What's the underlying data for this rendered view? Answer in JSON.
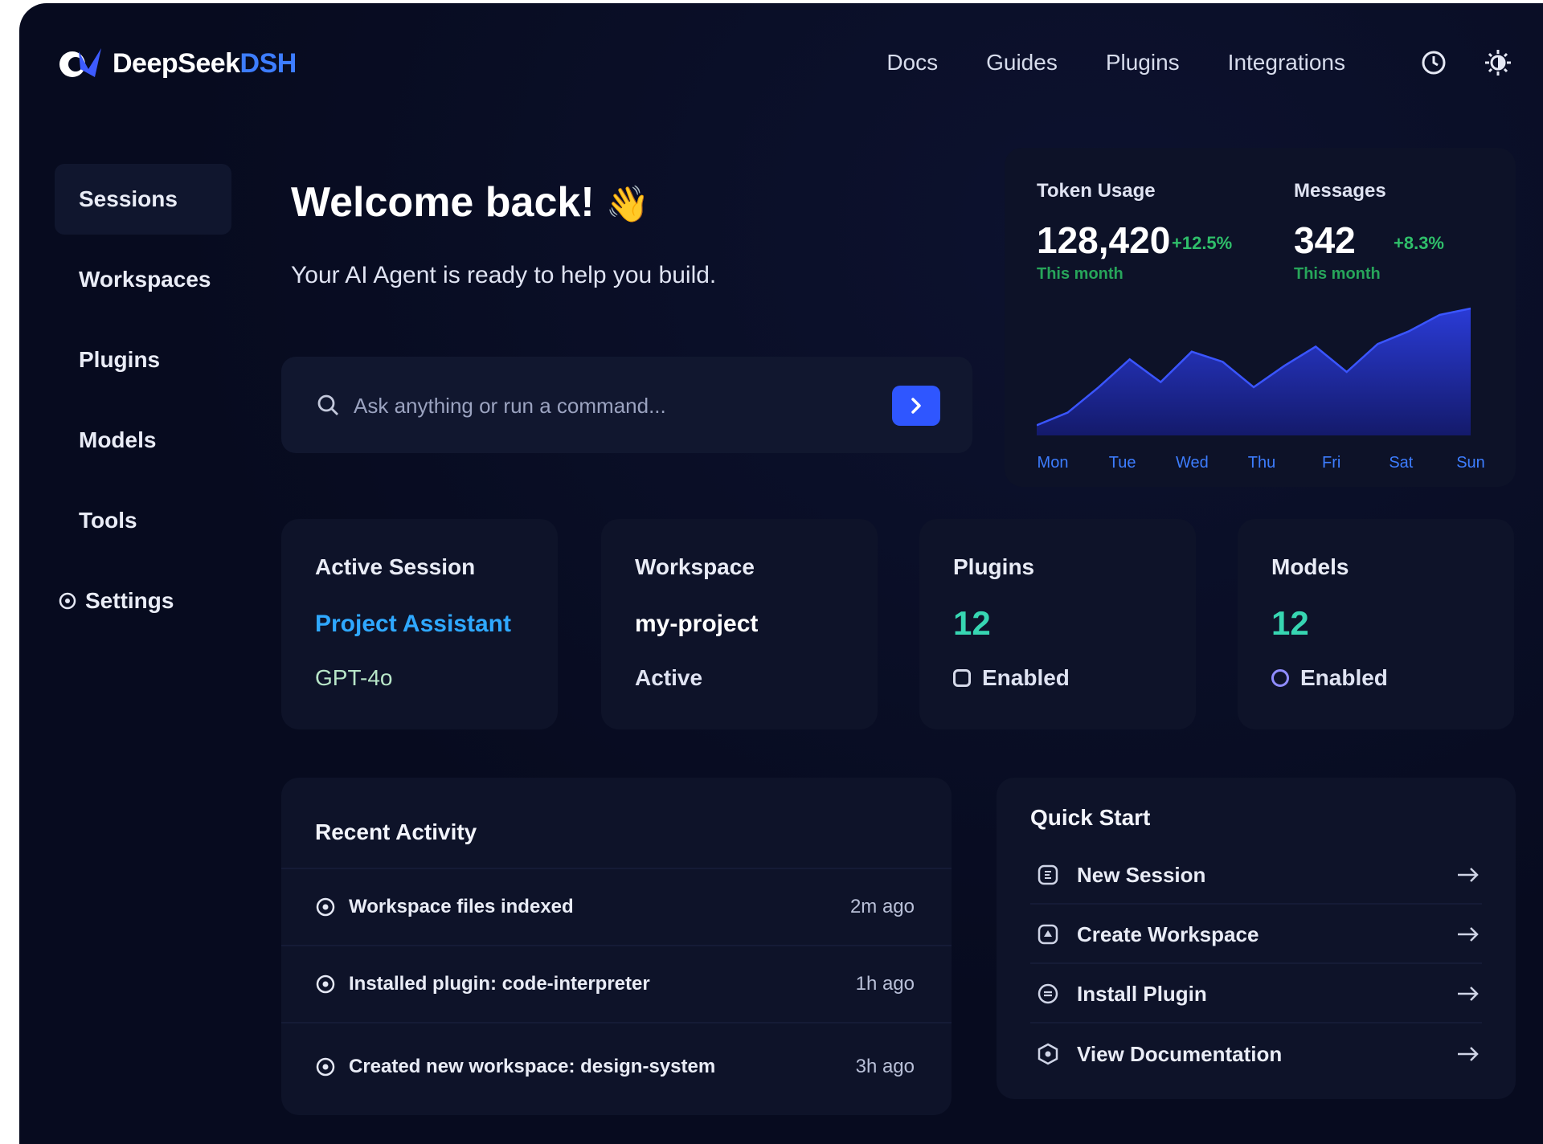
{
  "app": {
    "logo_main": "DeepSeek",
    "logo_accent": "DSH"
  },
  "topnav": {
    "items": [
      "Docs",
      "Guides",
      "Plugins",
      "Integrations"
    ]
  },
  "sidebar": {
    "items": [
      {
        "label": "Sessions",
        "active": true
      },
      {
        "label": "Workspaces"
      },
      {
        "label": "Plugins"
      },
      {
        "label": "Models"
      },
      {
        "label": "Tools"
      },
      {
        "label": "Settings",
        "icon": "gear-icon"
      }
    ]
  },
  "welcome": {
    "title": "Welcome back!",
    "emoji": "👋",
    "subtitle": "Your AI Agent is ready to help you build."
  },
  "command": {
    "placeholder": "Ask anything or run a command..."
  },
  "stats": {
    "token": {
      "label": "Token Usage",
      "value": "128,420",
      "delta": "+12.5%",
      "period": "This month"
    },
    "messages": {
      "label": "Messages",
      "value": "342",
      "delta": "+8.3%",
      "period": "This month"
    }
  },
  "chart_data": {
    "type": "area",
    "categories": [
      "Mon",
      "Tue",
      "Wed",
      "Thu",
      "Fri",
      "Sat",
      "Sun"
    ],
    "series": [
      {
        "values": [
          0.08,
          0.18,
          0.38,
          0.6,
          0.42,
          0.66,
          0.58,
          0.38,
          0.55,
          0.7,
          0.5,
          0.72,
          0.82,
          0.95,
          1.0
        ]
      }
    ],
    "colors": {
      "fill_top": "#2a3bd6",
      "fill_bottom": "#141a6b",
      "line": "#3a55ff",
      "axis_label": "#3d7dff"
    }
  },
  "cards": [
    {
      "title": "Active Session",
      "main": "Project Assistant",
      "sub": "GPT-4o",
      "main_color": "#2fa8ff",
      "sub_color": "#b8e6c8"
    },
    {
      "title": "Workspace",
      "main": "my-project",
      "sub": "Active",
      "main_color": "#ffffff"
    },
    {
      "title": "Plugins",
      "main": "12",
      "sub": "Enabled"
    },
    {
      "title": "Models",
      "main": "12",
      "sub": "Enabled"
    }
  ],
  "activity": {
    "title": "Recent Activity",
    "items": [
      {
        "text": "Workspace files indexed",
        "time": "2m ago"
      },
      {
        "text": "Installed plugin: code-interpreter",
        "time": "1h ago"
      },
      {
        "text": "Created new workspace: design-system",
        "time": "3h ago"
      }
    ]
  },
  "quick": {
    "title": "Quick Start",
    "items": [
      {
        "label": "New Session",
        "icon": "session-icon"
      },
      {
        "label": "Create Workspace",
        "icon": "workspace-icon"
      },
      {
        "label": "Install Plugin",
        "icon": "plugin-icon"
      },
      {
        "label": "View Documentation",
        "icon": "docs-icon"
      }
    ]
  }
}
